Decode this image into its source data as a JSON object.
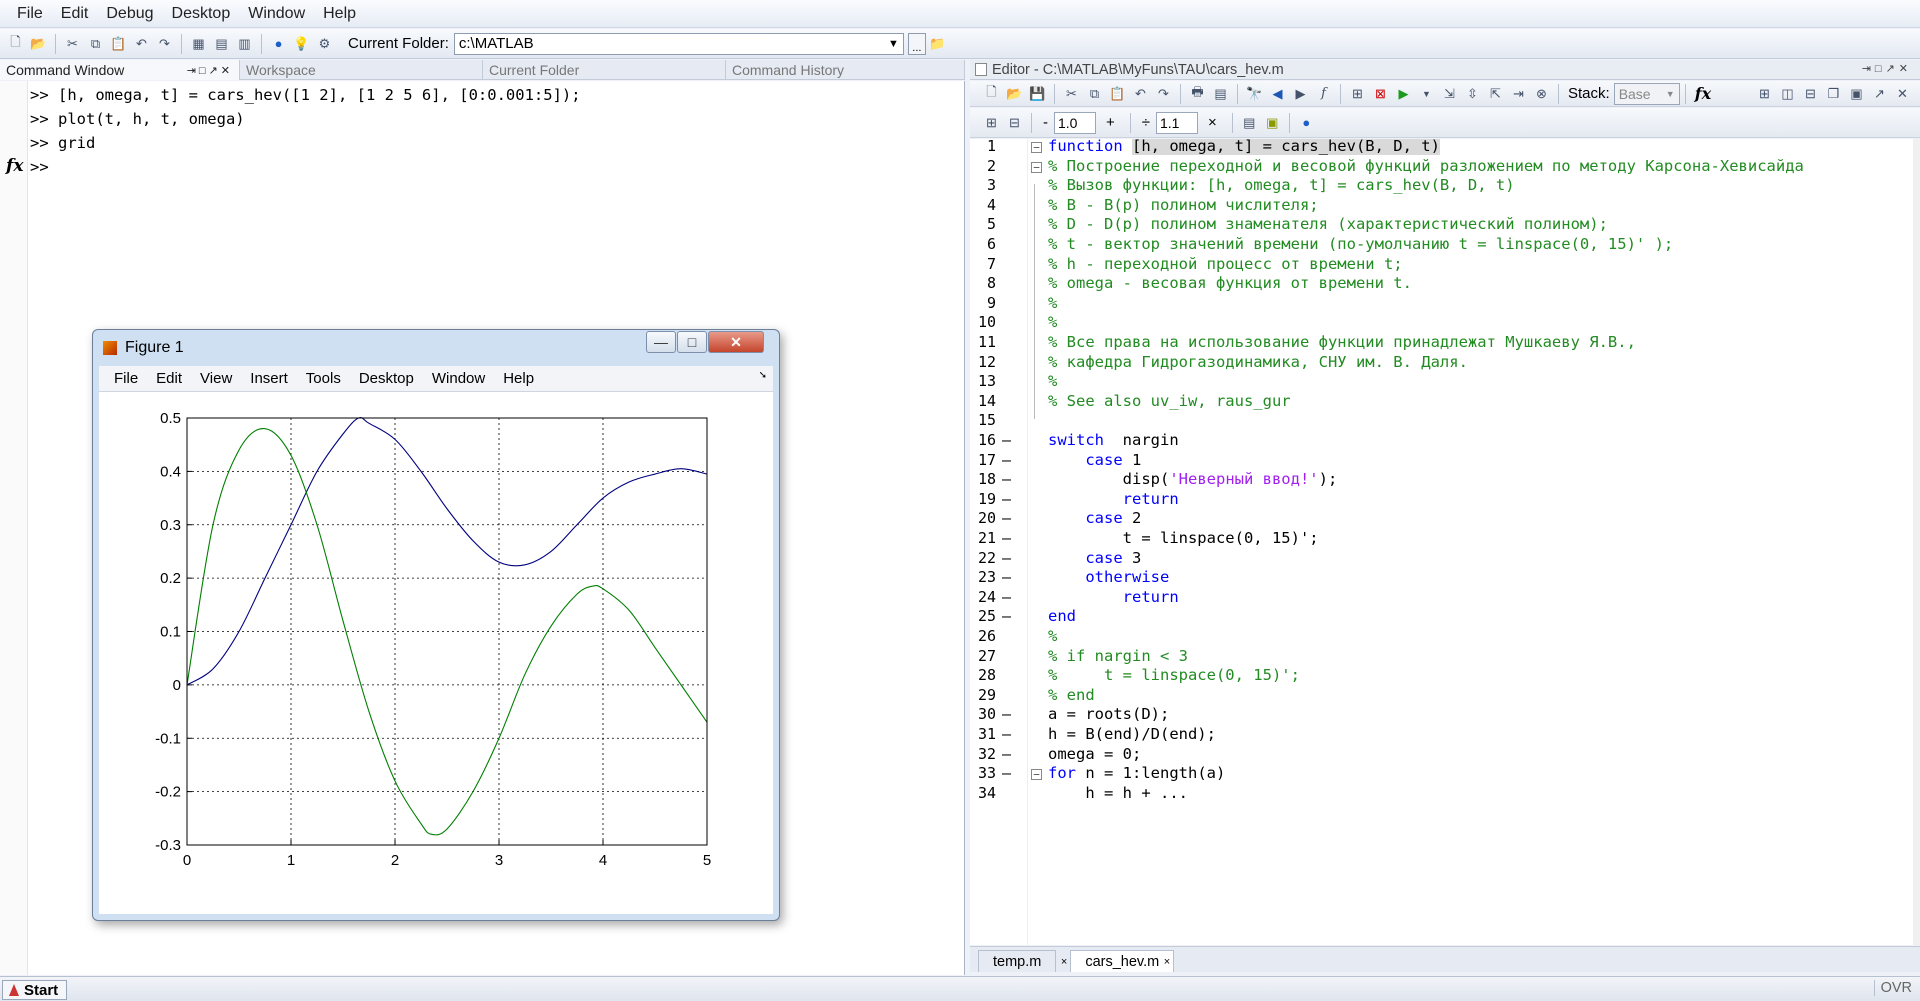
{
  "menubar": {
    "items": [
      "File",
      "Edit",
      "Debug",
      "Desktop",
      "Window",
      "Help"
    ]
  },
  "toolbar": {
    "current_folder_label": "Current Folder:",
    "current_folder_value": "c:\\MATLAB",
    "browse_label": "..."
  },
  "left_tabs": [
    "Command Window",
    "Workspace",
    "Current Folder",
    "Command History"
  ],
  "command_window": {
    "lines": [
      ">> [h, omega, t] = cars_hev([1 2], [1 2 5 6], [0:0.001:5]);",
      ">> plot(t, h, t, omega)",
      ">> grid",
      ">>"
    ],
    "fx_label": "fx"
  },
  "figure": {
    "title": "Figure 1",
    "menu": [
      "File",
      "Edit",
      "View",
      "Insert",
      "Tools",
      "Desktop",
      "Window",
      "Help"
    ]
  },
  "chart_data": {
    "type": "line",
    "xlim": [
      0,
      5
    ],
    "ylim": [
      -0.3,
      0.5
    ],
    "xticks": [
      "0",
      "1",
      "2",
      "3",
      "4",
      "5"
    ],
    "yticks": [
      "-0.3",
      "-0.2",
      "-0.1",
      "0",
      "0.1",
      "0.2",
      "0.3",
      "0.4",
      "0.5"
    ],
    "grid": true,
    "series": [
      {
        "color": "#00007f",
        "x": [
          0,
          0.25,
          0.5,
          0.75,
          1,
          1.25,
          1.5,
          1.65,
          1.75,
          2,
          2.25,
          2.5,
          2.75,
          3,
          3.25,
          3.5,
          3.75,
          4,
          4.25,
          4.5,
          4.75,
          5
        ],
        "y": [
          0,
          0.03,
          0.1,
          0.2,
          0.3,
          0.4,
          0.47,
          0.5,
          0.49,
          0.46,
          0.4,
          0.33,
          0.27,
          0.23,
          0.225,
          0.25,
          0.3,
          0.35,
          0.38,
          0.395,
          0.405,
          0.395
        ]
      },
      {
        "color": "#007f00",
        "x": [
          0,
          0.25,
          0.5,
          0.75,
          1,
          1.25,
          1.5,
          1.75,
          2,
          2.25,
          2.35,
          2.5,
          2.75,
          3,
          3.25,
          3.5,
          3.75,
          3.9,
          4,
          4.25,
          4.5,
          4.75,
          5
        ],
        "y": [
          0,
          0.3,
          0.44,
          0.48,
          0.43,
          0.3,
          0.12,
          -0.05,
          -0.18,
          -0.26,
          -0.28,
          -0.27,
          -0.2,
          -0.1,
          0.02,
          0.11,
          0.17,
          0.185,
          0.18,
          0.14,
          0.07,
          0,
          -0.07
        ]
      }
    ]
  },
  "editor": {
    "title": "Editor - C:\\MATLAB\\MyFuns\\TAU\\cars_hev.m",
    "zoom_minus": "-",
    "zoom_value": "1.0",
    "zoom_plus": "+",
    "div_symbol": "÷",
    "div_value": "1.1",
    "times_symbol": "×",
    "stack_label": "Stack:",
    "stack_value": "Base",
    "fx_label": "fx",
    "file_tabs": [
      "temp.m",
      "cars_hev.m"
    ]
  },
  "status": {
    "start_label": "Start",
    "ovr": "OVR"
  },
  "colors": {
    "keyword": "#0000ff",
    "comment": "#228b22",
    "string": "#a020f0",
    "accent": "#d9e4f1"
  }
}
